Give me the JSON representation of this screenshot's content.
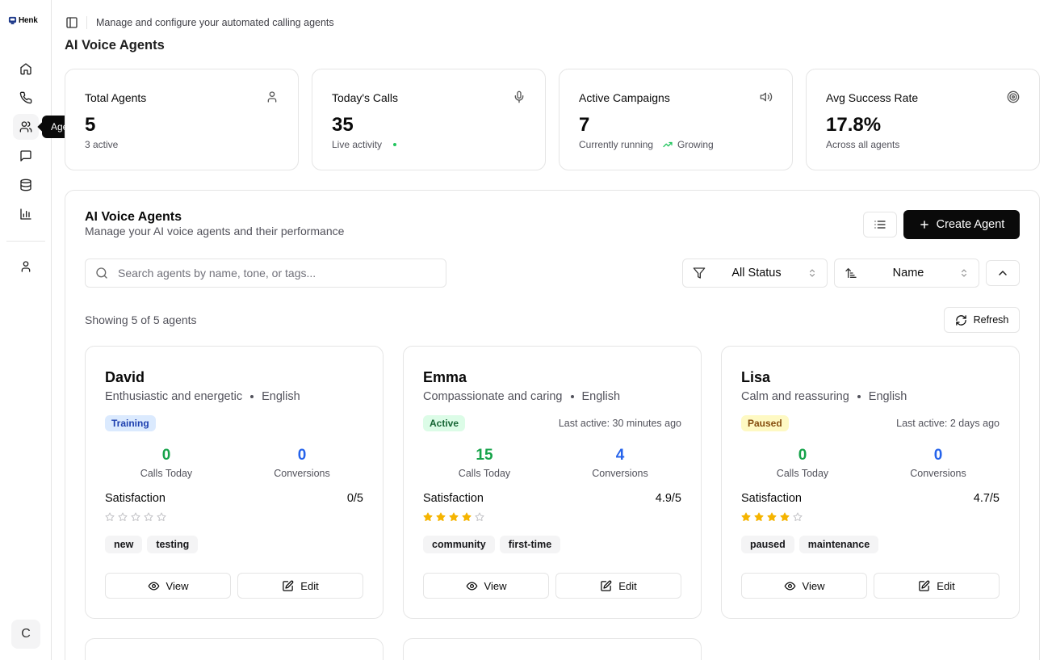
{
  "brand": {
    "name": "Henk"
  },
  "sidebar": {
    "tooltip": "Agents",
    "avatar_initial": "C"
  },
  "header": {
    "subtitle": "Manage and configure your automated calling agents",
    "title": "AI Voice Agents"
  },
  "stats": [
    {
      "label": "Total Agents",
      "value": "5",
      "sub": "3 active",
      "icon": "user-icon"
    },
    {
      "label": "Today's Calls",
      "value": "35",
      "sub": "Live activity",
      "icon": "microphone-icon"
    },
    {
      "label": "Active Campaigns",
      "value": "7",
      "sub": "Currently running",
      "trend": "Growing",
      "icon": "speaker-icon"
    },
    {
      "label": "Avg Success Rate",
      "value": "17.8%",
      "sub": "Across all agents",
      "icon": "target-icon"
    }
  ],
  "panel": {
    "title": "AI Voice Agents",
    "subtitle": "Manage your AI voice agents and their performance",
    "create_label": "Create Agent",
    "search_placeholder": "Search agents by name, tone, or tags...",
    "status_filter": "All Status",
    "sort_by": "Name",
    "count_text": "Showing 5 of 5 agents",
    "refresh_label": "Refresh"
  },
  "agents": [
    {
      "name": "David",
      "tone": "Enthusiastic and energetic",
      "language": "English",
      "status": "Training",
      "last_active": "",
      "calls_today": "0",
      "conversions": "0",
      "calls_label": "Calls Today",
      "conversions_label": "Conversions",
      "satisfaction_label": "Satisfaction",
      "satisfaction": "0/5",
      "stars": 0,
      "tags": [
        "new",
        "testing"
      ],
      "view_label": "View",
      "edit_label": "Edit"
    },
    {
      "name": "Emma",
      "tone": "Compassionate and caring",
      "language": "English",
      "status": "Active",
      "last_active": "Last active: 30 minutes ago",
      "calls_today": "15",
      "conversions": "4",
      "calls_label": "Calls Today",
      "conversions_label": "Conversions",
      "satisfaction_label": "Satisfaction",
      "satisfaction": "4.9/5",
      "stars": 4,
      "tags": [
        "community",
        "first-time"
      ],
      "view_label": "View",
      "edit_label": "Edit"
    },
    {
      "name": "Lisa",
      "tone": "Calm and reassuring",
      "language": "English",
      "status": "Paused",
      "last_active": "Last active: 2 days ago",
      "calls_today": "0",
      "conversions": "0",
      "calls_label": "Calls Today",
      "conversions_label": "Conversions",
      "satisfaction_label": "Satisfaction",
      "satisfaction": "4.7/5",
      "stars": 4,
      "tags": [
        "paused",
        "maintenance"
      ],
      "view_label": "View",
      "edit_label": "Edit"
    }
  ],
  "colors": {
    "green": "#16a34a",
    "blue": "#2563eb",
    "star": "#f5b400",
    "primary": "#0a0a0a"
  }
}
